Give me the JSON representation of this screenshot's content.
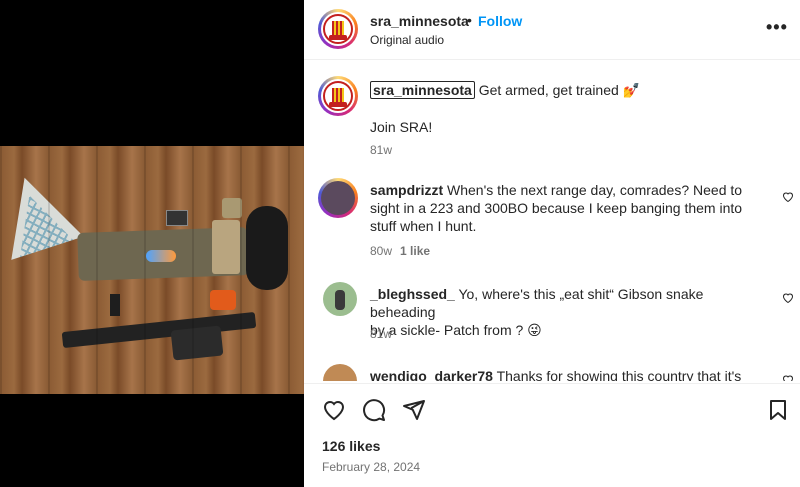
{
  "post": {
    "username": "sra_minnesota",
    "follow_label": "Follow",
    "separator": "•",
    "audio": "Original audio",
    "more_label": "•••"
  },
  "caption": {
    "username": "sra_minnesota",
    "text": "Get armed, get trained",
    "emoji": "💅",
    "body": "Join SRA!",
    "time": "81w"
  },
  "comments": [
    {
      "username": "sampdrizzt",
      "text_line1": "When's the next range day, comrades? Need to",
      "text_line2": "sight in a 223 and 300BO because I keep banging them into",
      "text_line3": "stuff when I hunt.",
      "time": "80w",
      "likes": "1 like"
    },
    {
      "username": "_bleghssed_",
      "text_line1": "Yo, where's this „eat shit“ Gibson snake beheading",
      "text_line2": "by a sickle- Patch from ?",
      "emoji": "😜",
      "time": "81w"
    },
    {
      "username": "wendigo_darker78",
      "text_line1": "Thanks for showing this country that it's"
    }
  ],
  "footer": {
    "likes": "126 likes",
    "date": "February 28, 2024"
  },
  "colors": {
    "follow": "#0095f6",
    "text": "#262626",
    "muted": "#737373",
    "media_bg": "#000000"
  }
}
